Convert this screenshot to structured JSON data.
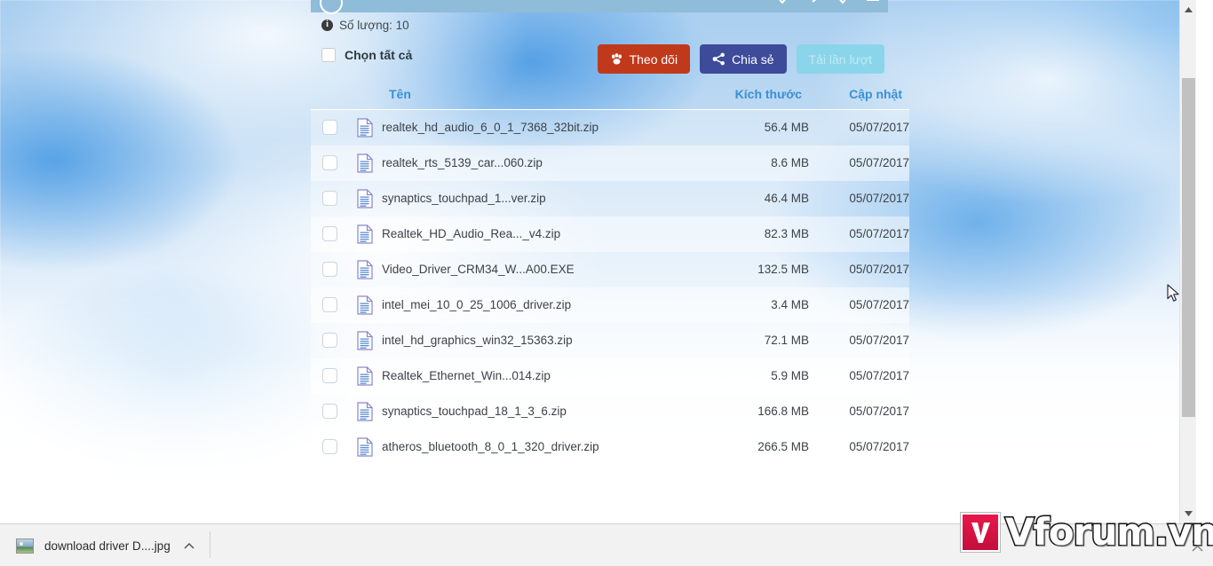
{
  "panel_toolbar": {
    "icons": [
      "chevron-down-icon",
      "link-icon",
      "chevron-down-icon",
      "minimize-icon"
    ],
    "avatar_icon": "user-avatar-icon"
  },
  "summary": {
    "info_icon": "info-icon",
    "count_label": "Số lượng: 10"
  },
  "actions": {
    "select_all_label": "Chọn tất cả",
    "select_all_checked": false,
    "follow_label": "Theo dõi",
    "follow_icon": "paw-icon",
    "follow_color": "#c0391b",
    "share_label": "Chia sẻ",
    "share_icon": "share-icon",
    "share_color": "#3e4a9a",
    "download_label": "Tải lần lượt",
    "download_color": "#8bd5ea",
    "download_disabled": true
  },
  "table": {
    "columns": [
      "Tên",
      "Kích thước",
      "Cập nhật"
    ],
    "rows": [
      {
        "name": "realtek_hd_audio_6_0_1_7368_32bit.zip",
        "size": "56.4 MB",
        "date": "05/07/2017",
        "icon": "file-icon"
      },
      {
        "name": "realtek_rts_5139_car...060.zip",
        "size": "8.6 MB",
        "date": "05/07/2017",
        "icon": "file-icon"
      },
      {
        "name": "synaptics_touchpad_1...ver.zip",
        "size": "46.4 MB",
        "date": "05/07/2017",
        "icon": "file-icon"
      },
      {
        "name": "Realtek_HD_Audio_Rea..._v4.zip",
        "size": "82.3 MB",
        "date": "05/07/2017",
        "icon": "file-icon"
      },
      {
        "name": "Video_Driver_CRM34_W...A00.EXE",
        "size": "132.5 MB",
        "date": "05/07/2017",
        "icon": "file-icon"
      },
      {
        "name": "intel_mei_10_0_25_1006_driver.zip",
        "size": "3.4 MB",
        "date": "05/07/2017",
        "icon": "file-icon"
      },
      {
        "name": "intel_hd_graphics_win32_15363.zip",
        "size": "72.1 MB",
        "date": "05/07/2017",
        "icon": "file-icon"
      },
      {
        "name": "Realtek_Ethernet_Win...014.zip",
        "size": "5.9 MB",
        "date": "05/07/2017",
        "icon": "file-icon"
      },
      {
        "name": "synaptics_touchpad_18_1_3_6.zip",
        "size": "166.8 MB",
        "date": "05/07/2017",
        "icon": "file-icon"
      },
      {
        "name": "atheros_bluetooth_8_0_1_320_driver.zip",
        "size": "266.5 MB",
        "date": "05/07/2017",
        "icon": "file-icon"
      }
    ]
  },
  "watermark": {
    "text": "Vforum.vn",
    "logo_letter": "V",
    "logo_color": "#d4123f"
  },
  "download_bar": {
    "item_label": "download driver D....jpg",
    "item_icon": "image-thumbnail-icon",
    "caret_icon": "chevron-up-icon",
    "close_icon": "close-icon"
  },
  "scrollbar": {
    "up_icon": "triangle-up-icon",
    "down_icon": "triangle-down-icon"
  }
}
